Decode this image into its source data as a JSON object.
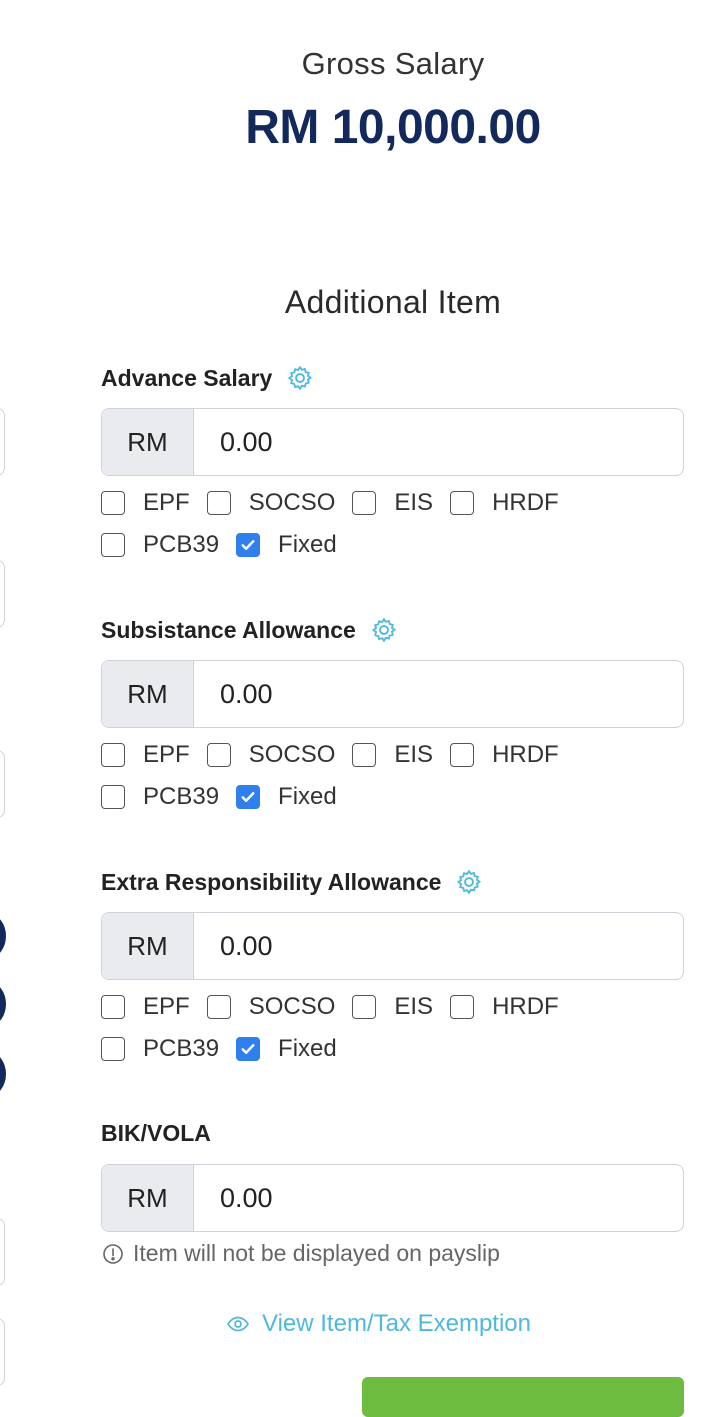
{
  "header": {
    "gross_label": "Gross Salary",
    "gross_value": "RM 10,000.00"
  },
  "section_title": "Additional Item",
  "currency_prefix": "RM",
  "items": [
    {
      "label": "Advance Salary",
      "value": "0.00",
      "has_settings": true,
      "options": [
        {
          "label": "EPF",
          "checked": false
        },
        {
          "label": "SOCSO",
          "checked": false
        },
        {
          "label": "EIS",
          "checked": false
        },
        {
          "label": "HRDF",
          "checked": false
        },
        {
          "label": "PCB39",
          "checked": false
        },
        {
          "label": "Fixed",
          "checked": true
        }
      ]
    },
    {
      "label": "Subsistance Allowance",
      "value": "0.00",
      "has_settings": true,
      "options": [
        {
          "label": "EPF",
          "checked": false
        },
        {
          "label": "SOCSO",
          "checked": false
        },
        {
          "label": "EIS",
          "checked": false
        },
        {
          "label": "HRDF",
          "checked": false
        },
        {
          "label": "PCB39",
          "checked": false
        },
        {
          "label": "Fixed",
          "checked": true
        }
      ]
    },
    {
      "label": "Extra Responsibility Allowance",
      "value": "0.00",
      "has_settings": true,
      "options": [
        {
          "label": "EPF",
          "checked": false
        },
        {
          "label": "SOCSO",
          "checked": false
        },
        {
          "label": "EIS",
          "checked": false
        },
        {
          "label": "HRDF",
          "checked": false
        },
        {
          "label": "PCB39",
          "checked": false
        },
        {
          "label": "Fixed",
          "checked": true
        }
      ]
    },
    {
      "label": "BIK/VOLA",
      "value": "0.00",
      "has_settings": false
    }
  ],
  "note": {
    "icon": "info-circle-icon",
    "text": "Item will not be displayed on payslip"
  },
  "view_link": {
    "icon": "eye-icon",
    "text": "View Item/Tax Exemption"
  },
  "colors": {
    "brand_navy": "#13295b",
    "link_blue": "#4fb8de",
    "check_blue": "#2f80ed",
    "green": "#6dbb3f"
  }
}
